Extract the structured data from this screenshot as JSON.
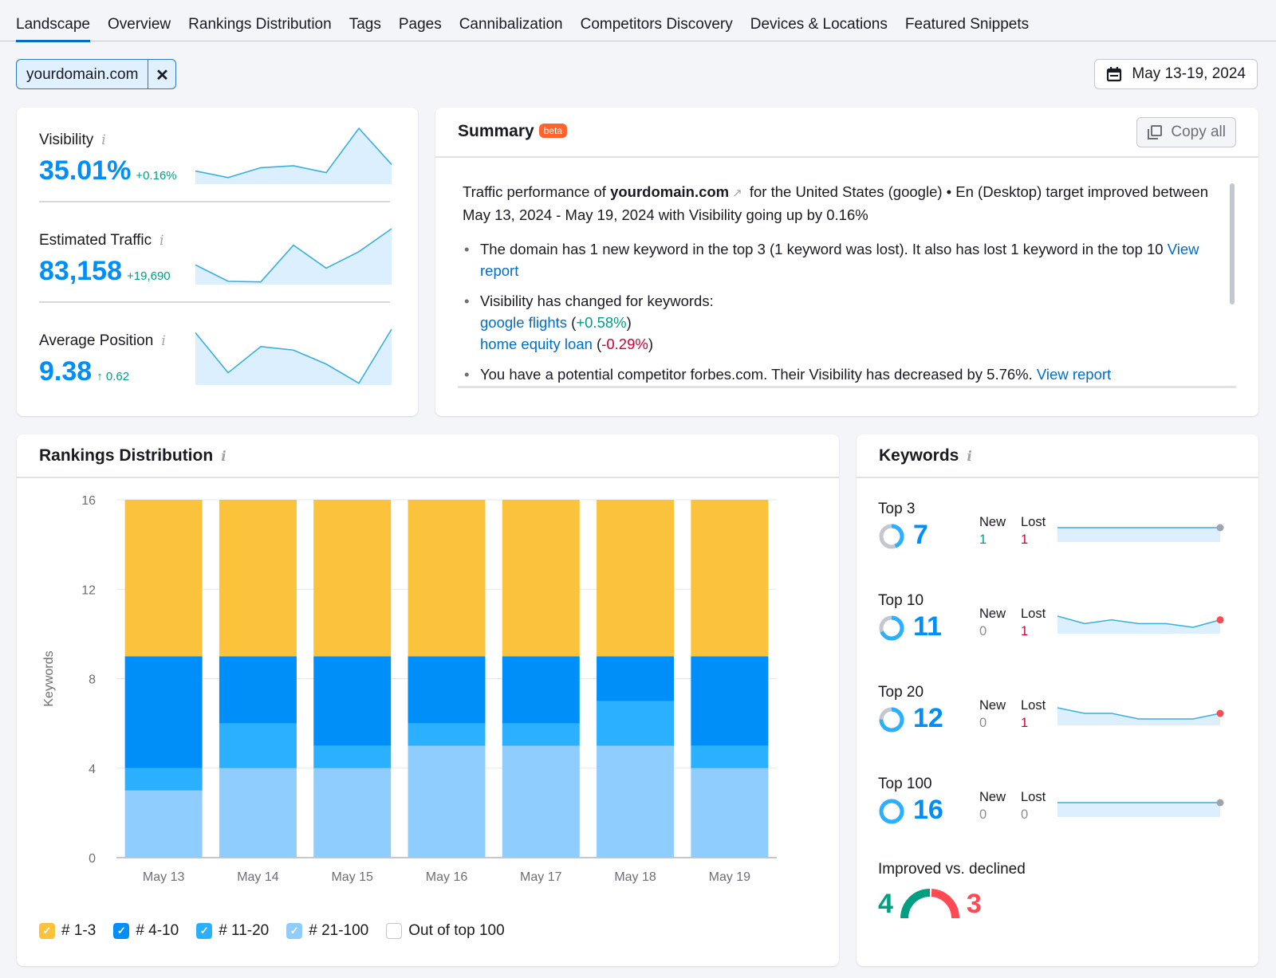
{
  "tabs": [
    {
      "label": "Landscape",
      "active": true
    },
    {
      "label": "Overview"
    },
    {
      "label": "Rankings Distribution"
    },
    {
      "label": "Tags"
    },
    {
      "label": "Pages"
    },
    {
      "label": "Cannibalization"
    },
    {
      "label": "Competitors Discovery"
    },
    {
      "label": "Devices & Locations"
    },
    {
      "label": "Featured Snippets"
    }
  ],
  "filter": {
    "domain": "yourdomain.com",
    "remove_icon": "close-icon",
    "remove_glyph": "✕"
  },
  "date_range": {
    "label": "May 13-19, 2024",
    "icon": "calendar-icon"
  },
  "metrics": [
    {
      "name": "Visibility",
      "value": "35.01%",
      "delta": "+0.16%",
      "spark": [
        4,
        2,
        5,
        5.6,
        3.5,
        17,
        6
      ],
      "info": "i"
    },
    {
      "name": "Estimated Traffic",
      "value": "83,158",
      "delta": "+19,690",
      "spark": [
        6,
        1,
        0.8,
        12,
        5,
        10,
        17
      ],
      "info": "i"
    },
    {
      "name": "Average Position",
      "value": "9.38",
      "delta": "↑ 0.62",
      "spark": [
        15,
        3.5,
        11,
        10,
        6,
        0.5,
        16
      ],
      "info": "i"
    }
  ],
  "summary": {
    "title": "Summary",
    "badge": "beta",
    "copy_label": "Copy all",
    "intro_pre": "Traffic performance of ",
    "intro_domain": "yourdomain.com",
    "intro_post": " for the United States (google) • En (Desktop) target improved between May 13, 2024 - May 19, 2024 with Visibility going up by 0.16%",
    "bullets": {
      "b1_text": "The domain has 1 new keyword in the top 3 (1 keyword was lost). It also has lost 1 keyword in the top 10 ",
      "b1_link": "View report",
      "b2_text": "Visibility has changed for keywords:",
      "kw1": "google flights",
      "kw1_change": "+0.58%",
      "kw2": "home equity loan",
      "kw2_change": "-0.29%",
      "b3_text": "You have a potential competitor forbes.com. Their Visibility has decreased by 5.76%. ",
      "b3_link": "View report"
    }
  },
  "rankings": {
    "title": "Rankings Distribution",
    "info": "i",
    "legend": [
      {
        "label": "# 1-3",
        "color": "#fbc23c",
        "checked": true
      },
      {
        "label": "# 4-10",
        "color": "#008ff8",
        "checked": true
      },
      {
        "label": "# 11-20",
        "color": "#2bb0ff",
        "checked": true
      },
      {
        "label": "# 21-100",
        "color": "#8fcdff",
        "checked": true
      },
      {
        "label": "Out of top 100",
        "color": "#ffffff",
        "checked": false
      }
    ]
  },
  "chart_data": {
    "type": "bar",
    "stacked": true,
    "title": "Rankings Distribution",
    "xlabel": "",
    "ylabel": "Keywords",
    "ylim": [
      0,
      16
    ],
    "yticks": [
      0,
      4,
      8,
      12,
      16
    ],
    "grid": true,
    "legend_position": "bottom-left",
    "categories": [
      "May 13",
      "May 14",
      "May 15",
      "May 16",
      "May 17",
      "May 18",
      "May 19"
    ],
    "series": [
      {
        "name": "# 21-100",
        "color": "#8fcdff",
        "values": [
          3,
          4,
          4,
          5,
          5,
          5,
          4
        ]
      },
      {
        "name": "# 11-20",
        "color": "#2bb0ff",
        "values": [
          1,
          2,
          1,
          1,
          1,
          2,
          1
        ]
      },
      {
        "name": "# 4-10",
        "color": "#008ff8",
        "values": [
          5,
          3,
          4,
          3,
          3,
          2,
          4
        ]
      },
      {
        "name": "# 1-3",
        "color": "#fbc23c",
        "values": [
          7,
          7,
          7,
          7,
          7,
          7,
          7
        ]
      }
    ]
  },
  "keywords": {
    "title": "Keywords",
    "info": "i",
    "rows": [
      {
        "label": "Top 3",
        "value": "7",
        "share": 0.44,
        "new_label": "New",
        "lost_label": "Lost",
        "new": "1",
        "lost": "1",
        "new_color": "#009f81",
        "lost_color": "#d1002f",
        "spark": [
          7,
          7,
          7,
          7,
          7,
          7,
          7
        ],
        "end_dot": "#a0a3ab"
      },
      {
        "label": "Top 10",
        "value": "11",
        "share": 0.69,
        "new_label": "New",
        "lost_label": "Lost",
        "new": "0",
        "lost": "1",
        "new_color": "#8b8e97",
        "lost_color": "#d1002f",
        "spark": [
          12,
          10,
          11,
          10,
          10,
          9,
          11
        ],
        "end_dot": "#ff4953"
      },
      {
        "label": "Top 20",
        "value": "12",
        "share": 0.75,
        "new_label": "New",
        "lost_label": "Lost",
        "new": "0",
        "lost": "1",
        "new_color": "#8b8e97",
        "lost_color": "#d1002f",
        "spark": [
          14,
          13,
          13,
          12,
          12,
          12,
          13
        ],
        "end_dot": "#ff4953"
      },
      {
        "label": "Top 100",
        "value": "16",
        "share": 1.0,
        "new_label": "New",
        "lost_label": "Lost",
        "new": "0",
        "lost": "0",
        "new_color": "#8b8e97",
        "lost_color": "#8b8e97",
        "spark": [
          16,
          16,
          16,
          16,
          16,
          16,
          16
        ],
        "end_dot": "#a0a3ab"
      }
    ],
    "improved_vs_declined": {
      "label": "Improved vs. declined",
      "improved": "4",
      "declined": "3",
      "improved_color": "#009f81",
      "declined_color": "#ff4953"
    }
  }
}
